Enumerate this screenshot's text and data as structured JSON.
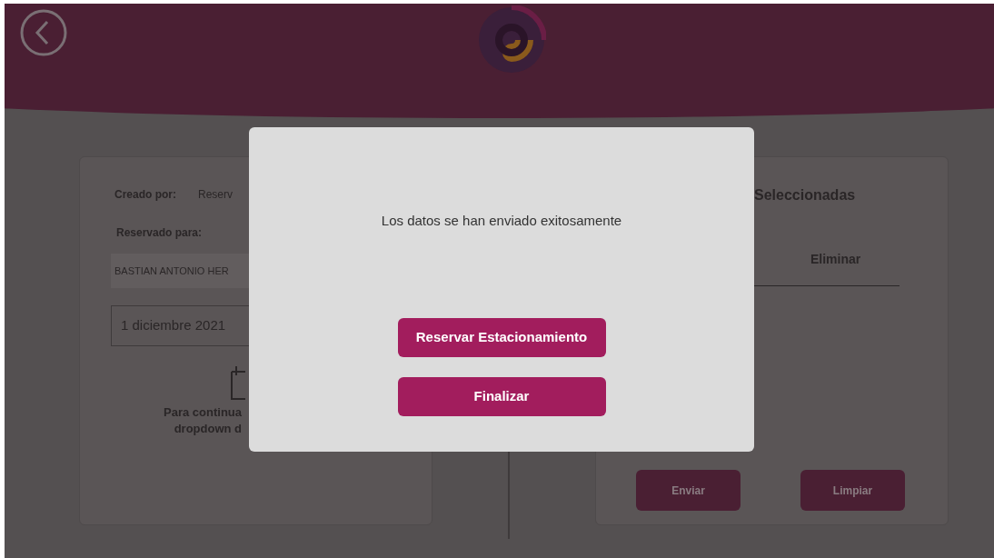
{
  "left_card": {
    "created_by_label": "Creado por:",
    "created_by_value": "Reserv",
    "reserved_for_label": "Reservado para:",
    "reserved_for_value": "BASTIAN ANTONIO HER",
    "date_value": "1 diciembre 2021",
    "hint_lines": [
      "Para continua",
      "dropdown d"
    ]
  },
  "right_card": {
    "title": "Seleccionadas",
    "column_header": "Eliminar",
    "buttons": [
      {
        "label": "Enviar"
      },
      {
        "label": "Limpiar"
      }
    ]
  },
  "modal": {
    "message": "Los datos se han enviado exitosamente",
    "buttons": [
      {
        "label": "Reservar Estacionamiento"
      },
      {
        "label": "Finalizar"
      }
    ]
  }
}
